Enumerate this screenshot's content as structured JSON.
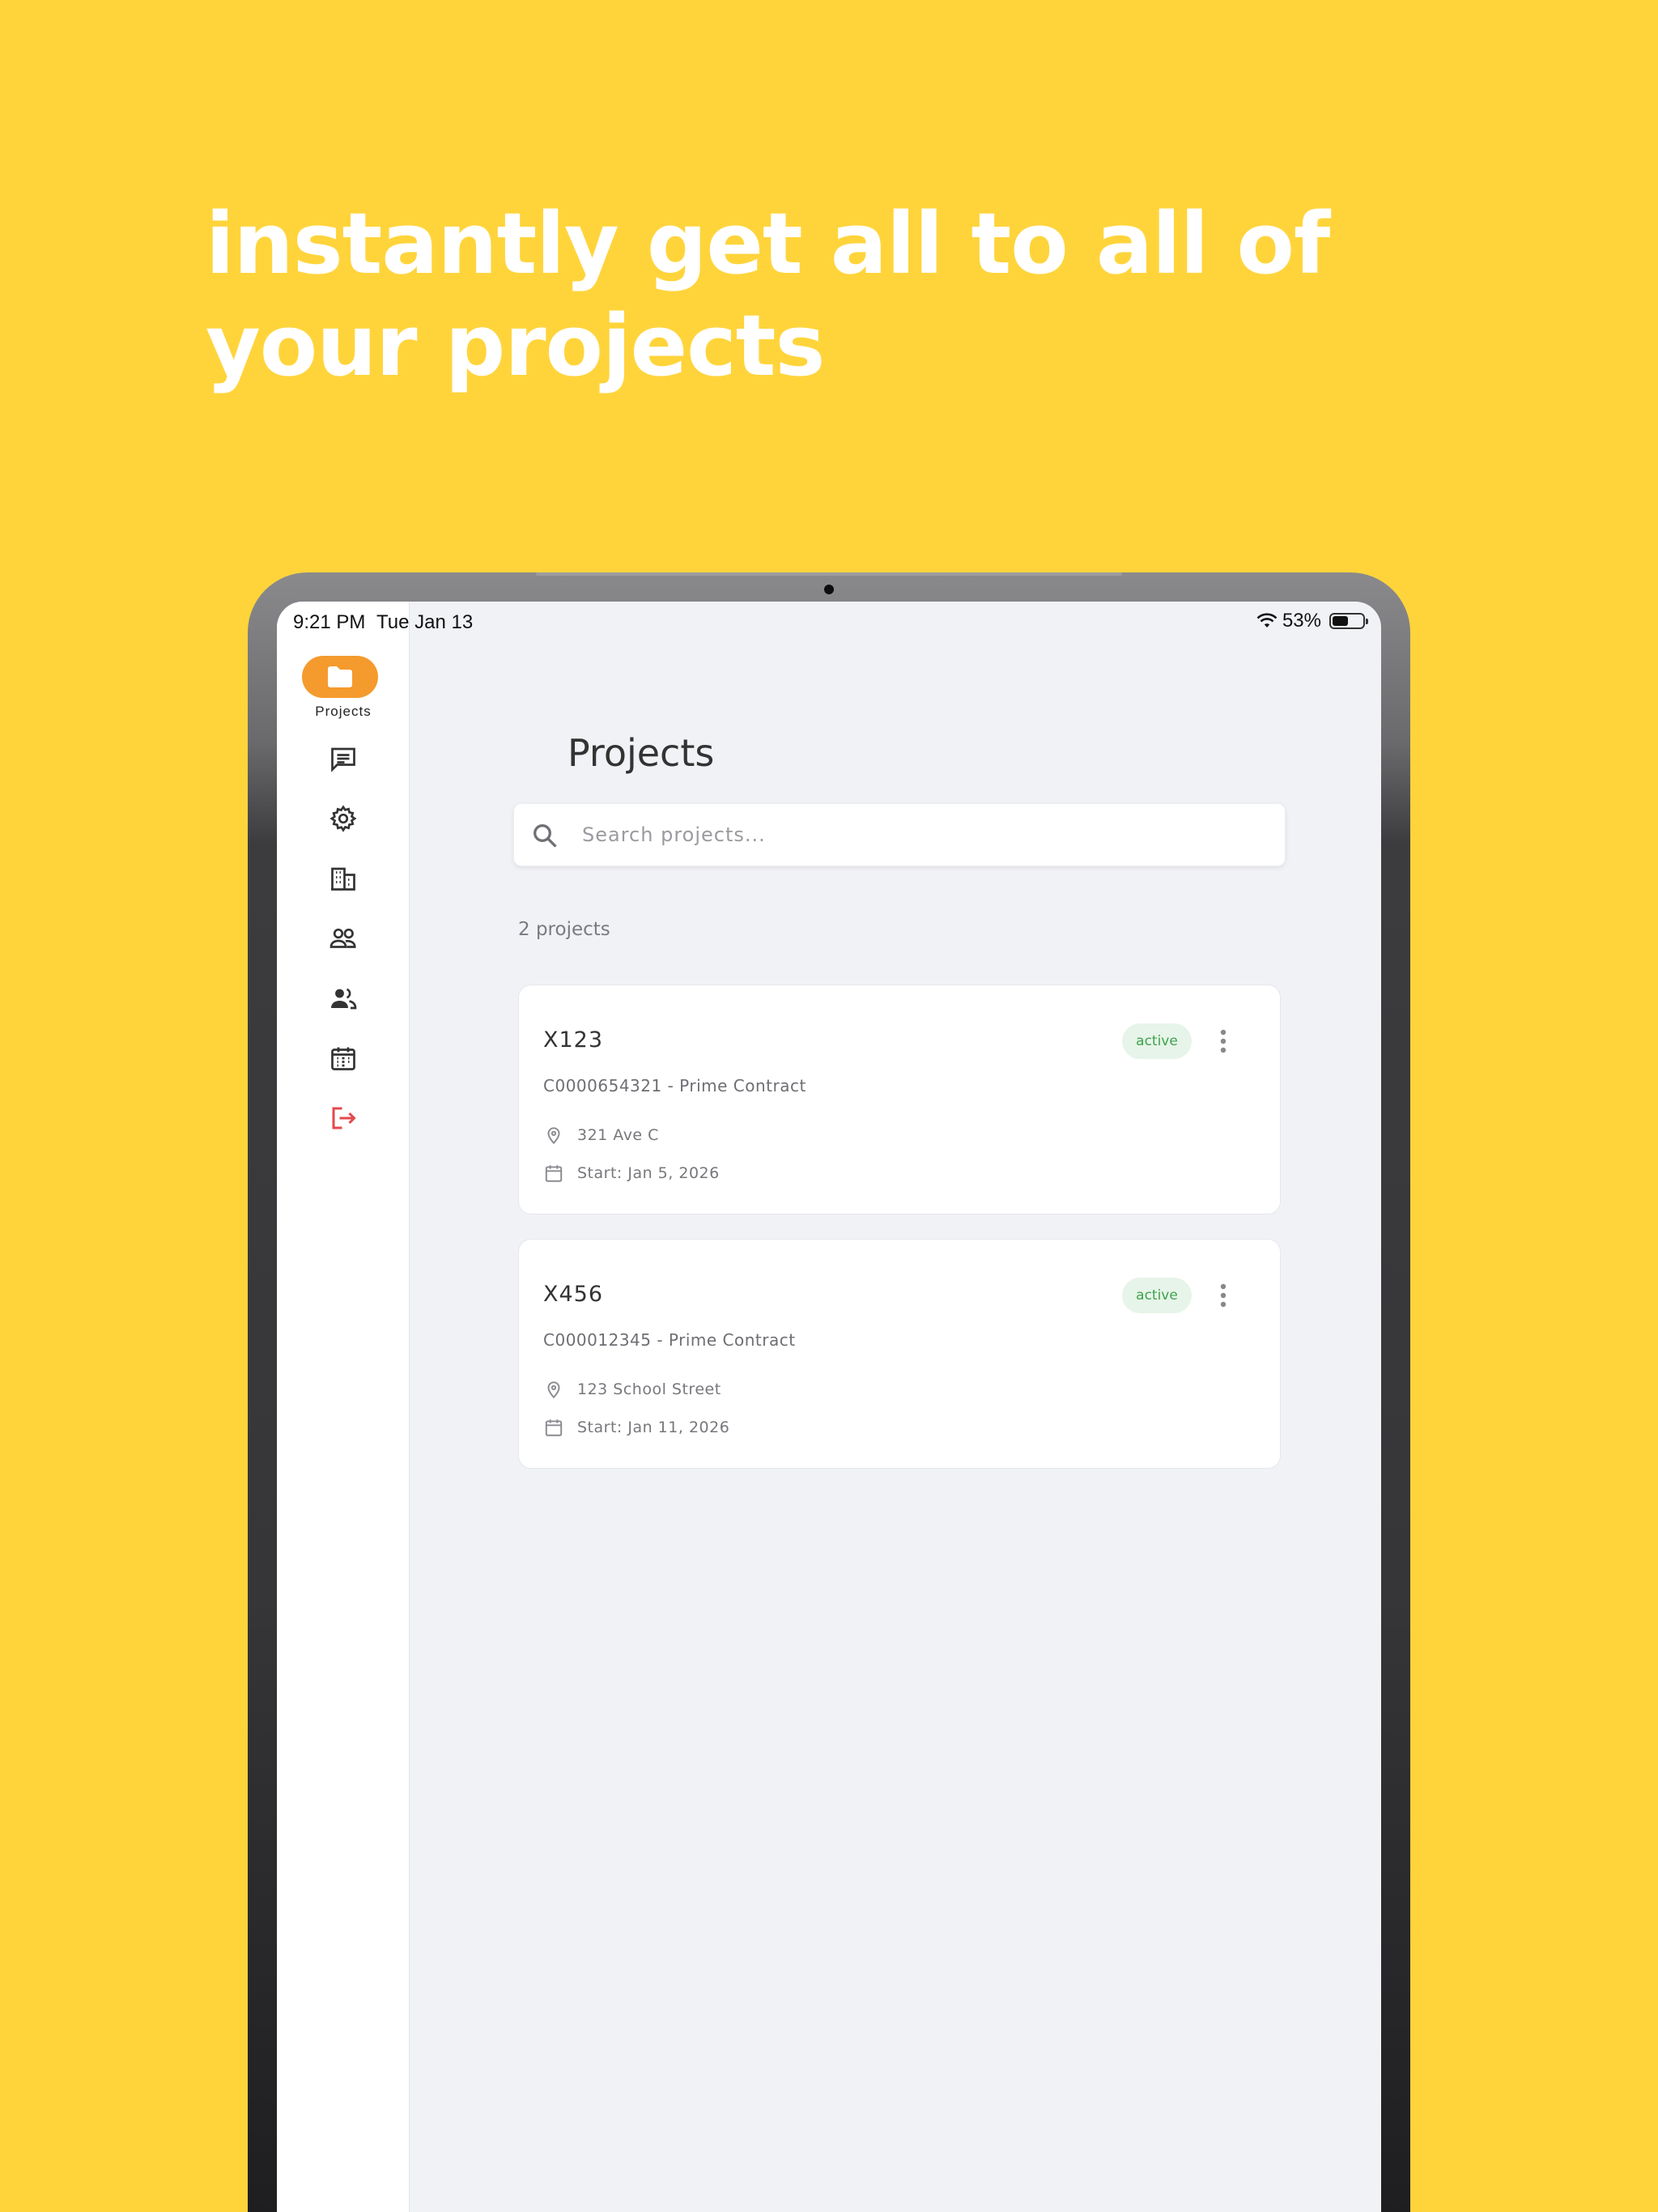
{
  "headline": "instantly get all to all of your projects",
  "status_bar": {
    "time": "9:21 PM",
    "date": "Tue Jan 13",
    "battery_percent": "53%",
    "battery_level": 0.53
  },
  "sidebar": {
    "active_label": "Projects",
    "items": [
      {
        "icon": "folder-icon"
      },
      {
        "icon": "messages-icon"
      },
      {
        "icon": "gear-icon"
      },
      {
        "icon": "building-icon"
      },
      {
        "icon": "team-icon"
      },
      {
        "icon": "people-icon"
      },
      {
        "icon": "calendar-icon"
      },
      {
        "icon": "logout-icon"
      }
    ]
  },
  "page": {
    "title": "Projects"
  },
  "search": {
    "placeholder": "Search projects..."
  },
  "project_count": "2 projects",
  "projects": [
    {
      "name": "X123",
      "contract": "C0000654321 - Prime Contract",
      "status": "active",
      "address": "321 Ave C",
      "start": "Start: Jan 5, 2026"
    },
    {
      "name": "X456",
      "contract": "C000012345 - Prime Contract",
      "status": "active",
      "address": "123 School Street",
      "start": "Start: Jan 11, 2026"
    }
  ],
  "colors": {
    "background": "#FFD43B",
    "accent": "#F59A2D",
    "status_active": "#3FA34D",
    "logout": "#E5484D"
  }
}
